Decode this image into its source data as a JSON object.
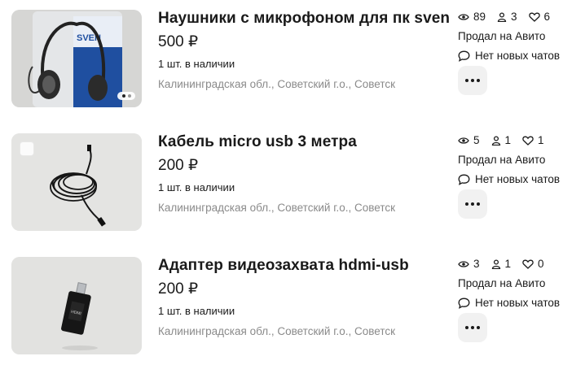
{
  "listings": [
    {
      "title": "Наушники с микрофоном для пк sven",
      "price": "500 ₽",
      "stock": "1 шт. в наличии",
      "location": "Калининградская обл., Советский г.о., Советск",
      "views": "89",
      "contacts": "3",
      "favorites": "6",
      "status": "Продал на Авито",
      "chats": "Нет новых чатов",
      "image_label": "SVEN"
    },
    {
      "title": "Кабель micro usb 3 метра",
      "price": "200 ₽",
      "stock": "1 шт. в наличии",
      "location": "Калининградская обл., Советский г.о., Советск",
      "views": "5",
      "contacts": "1",
      "favorites": "1",
      "status": "Продал на Авито",
      "chats": "Нет новых чатов"
    },
    {
      "title": "Адаптер видеозахвата hdmi-usb",
      "price": "200 ₽",
      "stock": "1 шт. в наличии",
      "location": "Калининградская обл., Советский г.о., Советск",
      "views": "3",
      "contacts": "1",
      "favorites": "0",
      "status": "Продал на Авито",
      "chats": "Нет новых чатов",
      "image_label": "HDMI"
    }
  ],
  "icons": {
    "views": "eye-icon",
    "contacts": "person-icon",
    "favorites": "heart-icon",
    "chats": "chat-bubble-icon",
    "more": "more-dots-icon"
  }
}
